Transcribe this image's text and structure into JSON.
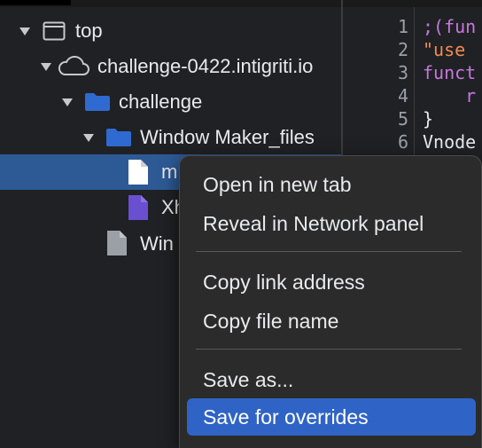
{
  "navigator": {
    "items": [
      {
        "label": "top",
        "icon": "frame-icon"
      },
      {
        "label": "challenge-0422.intigriti.io",
        "icon": "cloud-icon"
      },
      {
        "label": "challenge",
        "icon": "folder-icon"
      },
      {
        "label": "Window Maker_files",
        "icon": "folder-icon"
      },
      {
        "label": "m",
        "icon": "file-icon"
      },
      {
        "label": "Xh",
        "icon": "script-file-icon"
      },
      {
        "label": "Win",
        "icon": "document-file-icon"
      }
    ]
  },
  "code": {
    "line_numbers": [
      "1",
      "2",
      "3",
      "4",
      "5",
      "6"
    ],
    "lines": [
      ";(fun",
      "\"use ",
      "funct",
      "    r",
      "}",
      "Vnode"
    ]
  },
  "context_menu": {
    "items": [
      "Open in new tab",
      "Reveal in Network panel",
      "Copy link address",
      "Copy file name",
      "Save as...",
      "Save for overrides"
    ]
  },
  "colors": {
    "selection": "#2d5a95",
    "menu_highlight": "#2f64c6",
    "folder": "#2f6ad1",
    "script_file": "#6a4fd0",
    "keyword": "#c678dd",
    "string": "#f08b55"
  }
}
